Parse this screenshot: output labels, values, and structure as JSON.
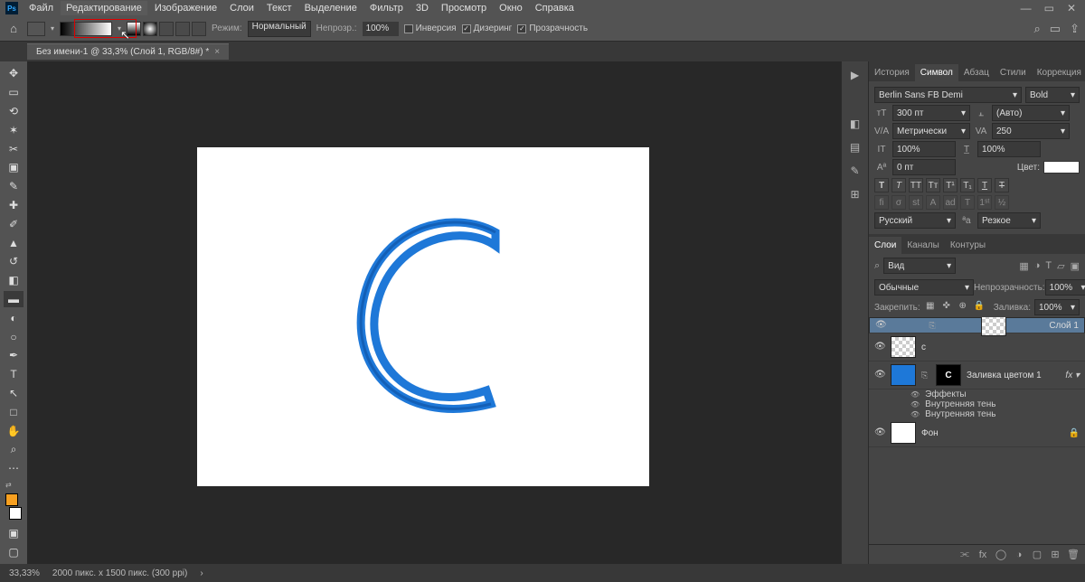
{
  "menubar": {
    "items": [
      "Файл",
      "Редактирование",
      "Изображение",
      "Слои",
      "Текст",
      "Выделение",
      "Фильтр",
      "3D",
      "Просмотр",
      "Окно",
      "Справка"
    ]
  },
  "optbar": {
    "mode_label": "Режим:",
    "mode_value": "Нормальный",
    "opacity_label": "Непрозр.:",
    "opacity_value": "100%",
    "chk_invert": "Инверсия",
    "chk_dither": "Дизеринг",
    "chk_trans": "Прозрачность"
  },
  "doctab": {
    "title": "Без имени-1 @ 33,3% (Слой 1, RGB/8#) *"
  },
  "panel_tabs_top": {
    "items": [
      "История",
      "Символ",
      "Абзац",
      "Стили",
      "Коррекция"
    ],
    "active": 1
  },
  "char": {
    "font": "Berlin Sans FB Demi",
    "weight": "Bold",
    "size": "300 пт",
    "leading": "(Авто)",
    "kerning": "Метрически",
    "tracking": "250",
    "vscale": "100%",
    "hscale": "100%",
    "baseline": "0 пт",
    "color_label": "Цвет:",
    "lang": "Русский",
    "aa": "Резкое"
  },
  "panel_tabs_lay": {
    "items": [
      "Слои",
      "Каналы",
      "Контуры"
    ],
    "active": 0
  },
  "layers": {
    "filter_label": "Вид",
    "blend_label": "Обычные",
    "opacity_label": "Непрозрачность:",
    "opacity_val": "100%",
    "lock_label": "Закрепить:",
    "fill_label": "Заливка:",
    "fill_val": "100%",
    "items": [
      {
        "name": "Слой 1",
        "thumb": "checker",
        "selected": true
      },
      {
        "name": "с",
        "thumb": "checker"
      },
      {
        "name": "Заливка цветом 1",
        "thumb": "blue",
        "mask": "C",
        "fx": true
      },
      {
        "name": "Фон",
        "thumb": "white",
        "locked": true
      }
    ],
    "fx_header": "Эффекты",
    "fx_items": [
      "Внутренняя тень",
      "Внутренняя тень"
    ]
  },
  "status": {
    "zoom": "33,33%",
    "docinfo": "2000 пикс. x 1500 пикс. (300 ppi)"
  }
}
